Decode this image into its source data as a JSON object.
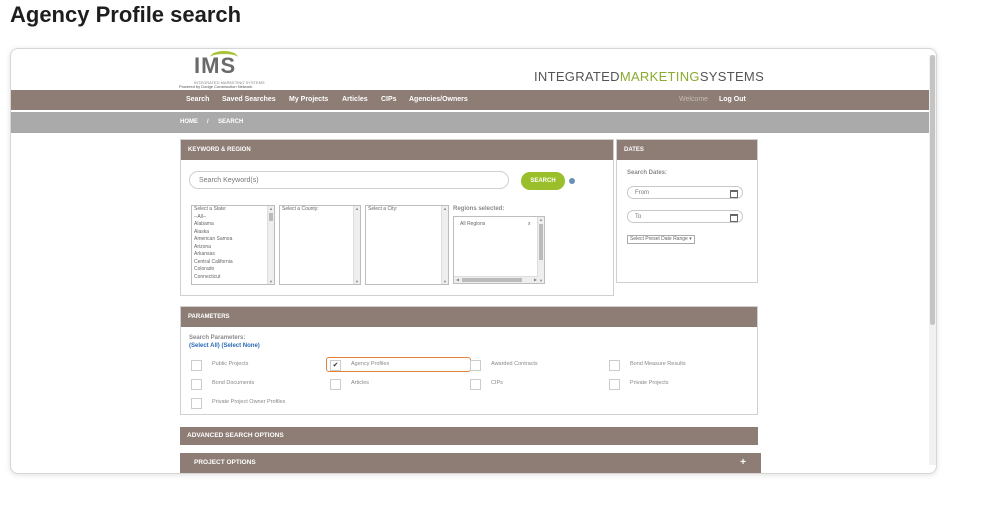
{
  "doc_title": "Agency Profile search",
  "header": {
    "logo_text": "IMS",
    "logo_tagline": "INTEGRATED MARKETING SYSTEMS",
    "powered_by": "Powered by Dodge Construction Network",
    "brand_left": "INTEGRATED",
    "brand_mid": "MARKETING",
    "brand_right": "SYSTEMS",
    "accent_color": "#9bbf2a",
    "bar_color": "#8d7d74"
  },
  "nav": {
    "items": [
      "Search",
      "Saved Searches",
      "My Projects",
      "Articles",
      "CIPs",
      "Agencies/Owners"
    ],
    "welcome": "Welcome",
    "logout": "Log Out"
  },
  "breadcrumb": {
    "home": "HOME",
    "separator": "/",
    "current": "SEARCH"
  },
  "keyword_region": {
    "title": "KEYWORD & REGION",
    "search_placeholder": "Search Keyword(s)",
    "search_button": "SEARCH",
    "state_options": [
      "Select a State:",
      "--All--",
      "Alabama",
      "Alaska",
      "American Samoa",
      "Arizona",
      "Arkansas",
      "Central California",
      "Colorado",
      "Connecticut"
    ],
    "county_label": "Select a County:",
    "city_label": "Select a City:",
    "regions_label": "Regions selected:",
    "regions_value": "All Regions",
    "regions_remove": "x"
  },
  "dates": {
    "title": "DATES",
    "label": "Search Dates:",
    "from_placeholder": "From",
    "to_placeholder": "To",
    "preset": "Select Preset Date Range"
  },
  "parameters": {
    "title": "PARAMETERS",
    "label": "Search Parameters:",
    "select_all": "(Select All)",
    "select_none": "(Select None)",
    "items": [
      {
        "label": "Public Projects",
        "checked": false
      },
      {
        "label": "Agency Profiles",
        "checked": true
      },
      {
        "label": "Awarded Contracts",
        "checked": false
      },
      {
        "label": "Bond Measure Results",
        "checked": false
      },
      {
        "label": "Bond Documents",
        "checked": false
      },
      {
        "label": "Articles",
        "checked": false
      },
      {
        "label": "CIPs",
        "checked": false
      },
      {
        "label": "Private Projects",
        "checked": false
      },
      {
        "label": "Private Project Owner Profiles",
        "checked": false
      }
    ]
  },
  "advanced": {
    "title": "ADVANCED SEARCH OPTIONS"
  },
  "project_options": {
    "title": "PROJECT OPTIONS",
    "expand": "+"
  }
}
